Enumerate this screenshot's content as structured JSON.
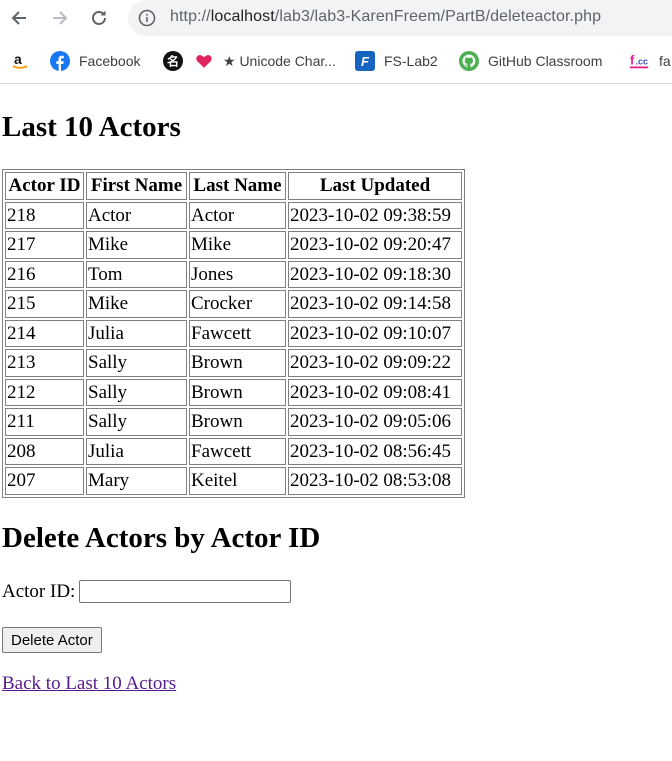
{
  "browser": {
    "url_prefix": "http://",
    "url_host": "localhost",
    "url_path": "/lab3/lab3-KarenFreem/PartB/deleteactor.php",
    "bookmarks": [
      {
        "label": "",
        "icon": "amazon-icon"
      },
      {
        "label": "Facebook",
        "icon": "facebook-icon"
      },
      {
        "label": "",
        "icon": "nametag-icon"
      },
      {
        "label": "★ Unicode Char...",
        "icon": "heart-icon"
      },
      {
        "label": "FS-Lab2",
        "icon": "fs-icon"
      },
      {
        "label": "GitHub Classroom",
        "icon": "github-icon"
      },
      {
        "label": "fa",
        "icon": "fcc-icon"
      }
    ]
  },
  "page": {
    "title": "Last 10 Actors",
    "table": {
      "headers": [
        "Actor ID",
        "First Name",
        "Last Name",
        "Last Updated"
      ],
      "rows": [
        [
          "218",
          "Actor",
          "Actor",
          "2023-10-02 09:38:59"
        ],
        [
          "217",
          "Mike",
          "Mike",
          "2023-10-02 09:20:47"
        ],
        [
          "216",
          "Tom",
          "Jones",
          "2023-10-02 09:18:30"
        ],
        [
          "215",
          "Mike",
          "Crocker",
          "2023-10-02 09:14:58"
        ],
        [
          "214",
          "Julia",
          "Fawcett",
          "2023-10-02 09:10:07"
        ],
        [
          "213",
          "Sally",
          "Brown",
          "2023-10-02 09:09:22"
        ],
        [
          "212",
          "Sally",
          "Brown",
          "2023-10-02 09:08:41"
        ],
        [
          "211",
          "Sally",
          "Brown",
          "2023-10-02 09:05:06"
        ],
        [
          "208",
          "Julia",
          "Fawcett",
          "2023-10-02 08:56:45"
        ],
        [
          "207",
          "Mary",
          "Keitel",
          "2023-10-02 08:53:08"
        ]
      ]
    },
    "delete_heading": "Delete Actors by Actor ID",
    "actor_id_label": "Actor ID:",
    "actor_id_value": "",
    "delete_button": "Delete Actor",
    "back_link": "Back to Last 10 Actors"
  },
  "colors": {
    "link_visited": "#551a8b",
    "omnibox_bg": "#f1f3f4",
    "facebook_blue": "#1877f2"
  }
}
